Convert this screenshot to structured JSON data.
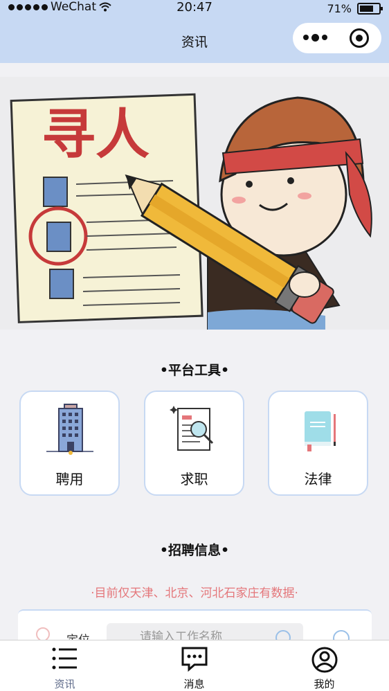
{
  "status_bar": {
    "carrier": "WeChat",
    "time": "20:47",
    "battery": "71%"
  },
  "nav": {
    "title": "资讯"
  },
  "banner": {
    "sign_text": "寻人"
  },
  "tools_section": {
    "title": "•平台工具•",
    "items": [
      {
        "label": "聘用",
        "icon": "office-building-icon"
      },
      {
        "label": "求职",
        "icon": "resume-search-icon"
      },
      {
        "label": "法律",
        "icon": "law-book-icon"
      }
    ]
  },
  "recruit_section": {
    "title": "•招聘信息•",
    "notice": "·目前仅天津、北京、河北石家庄有数据·"
  },
  "search": {
    "location_label": "定位",
    "placeholder": "请输入工作名称"
  },
  "tabbar": {
    "items": [
      {
        "label": "资讯",
        "icon": "list-icon"
      },
      {
        "label": "消息",
        "icon": "message-icon"
      },
      {
        "label": "我的",
        "icon": "user-icon"
      }
    ]
  },
  "colors": {
    "nav_bg": "#c7d9f3",
    "card_border": "#c7d9f3",
    "notice": "#e4767a",
    "page_bg": "#f1f1f4"
  }
}
